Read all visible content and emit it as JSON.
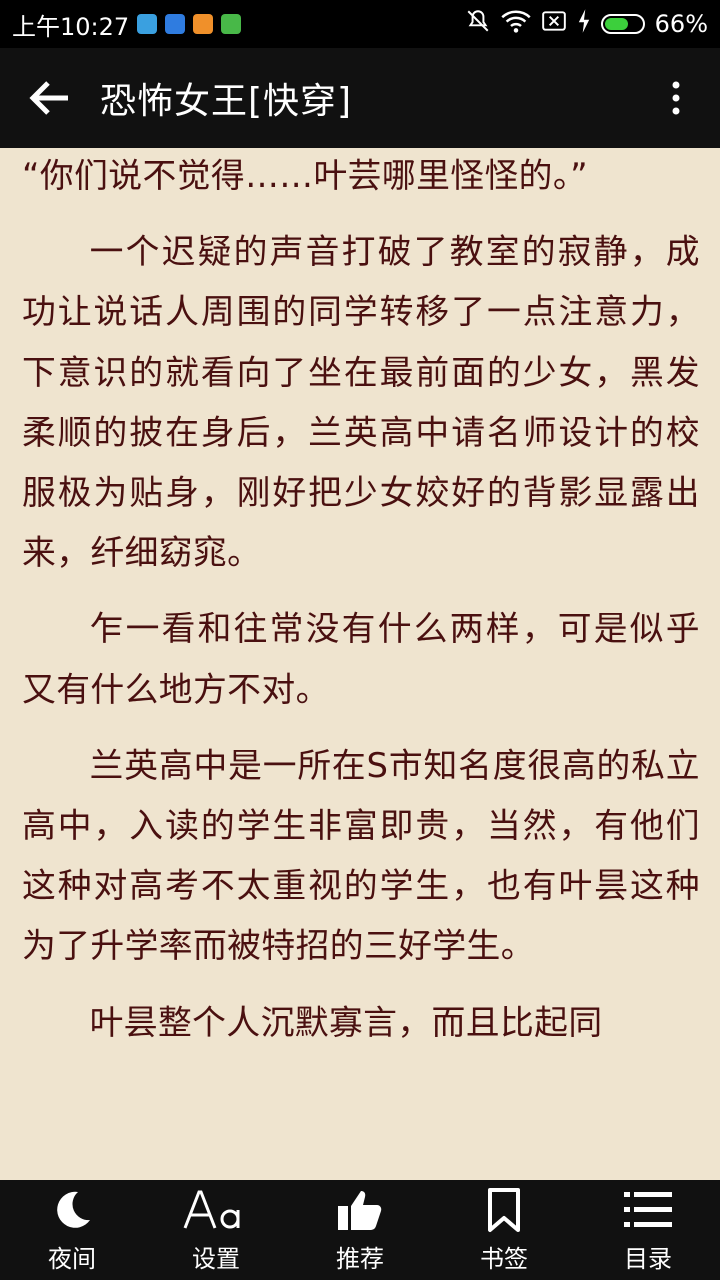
{
  "status_bar": {
    "time": "上午10:27",
    "battery_percent_label": "66%",
    "battery_level": 0.66
  },
  "toolbar": {
    "title": "恐怖女王[快穿]"
  },
  "reader": {
    "paragraphs": [
      {
        "text": "“你们说不觉得……叶芸哪里怪怪的。”",
        "continued": true
      },
      {
        "text": "一个迟疑的声音打破了教室的寂静，成功让说话人周围的同学转移了一点注意力，下意识的就看向了坐在最前面的少女，黑发柔顺的披在身后，兰英高中请名师设计的校服极为贴身，刚好把少女姣好的背影显露出来，纤细窈窕。"
      },
      {
        "text": "乍一看和往常没有什么两样，可是似乎又有什么地方不对。"
      },
      {
        "text": "兰英高中是一所在S市知名度很高的私立高中，入读的学生非富即贵，当然，有他们这种对高考不太重视的学生，也有叶昙这种为了升学率而被特招的三好学生。"
      },
      {
        "text": "叶昙整个人沉默寡言，而且比起同"
      }
    ]
  },
  "bottom_nav": {
    "items": [
      {
        "label": "夜间",
        "icon": "moon-icon"
      },
      {
        "label": "设置",
        "icon": "font-settings-icon"
      },
      {
        "label": "推荐",
        "icon": "thumbs-up-icon"
      },
      {
        "label": "书签",
        "icon": "bookmark-icon"
      },
      {
        "label": "目录",
        "icon": "list-icon"
      }
    ]
  },
  "colors": {
    "page_background": "#efe4cf",
    "text": "#4a1010",
    "bars": "#111111",
    "battery": "#3ccf3c"
  }
}
